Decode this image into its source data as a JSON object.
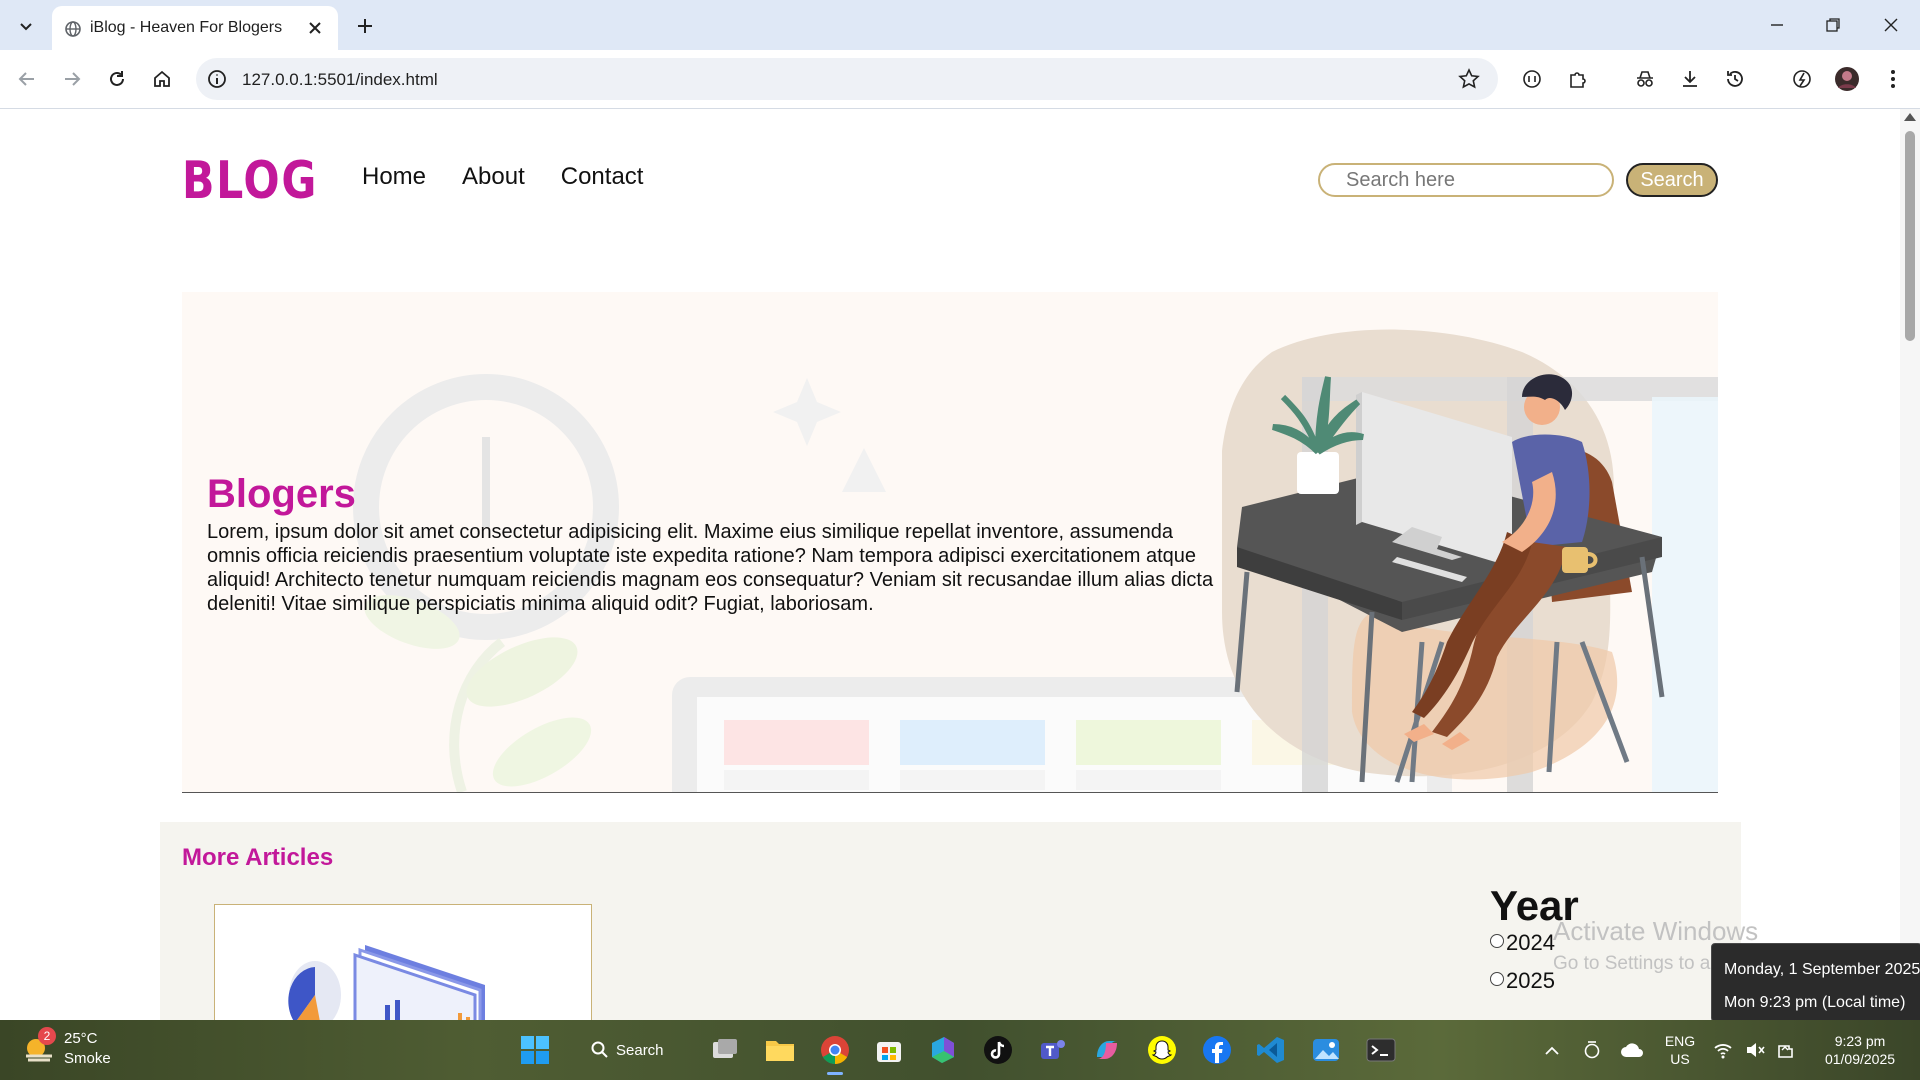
{
  "browser": {
    "tab_title": "iBlog - Heaven For Blogers",
    "url": "127.0.0.1:5501/index.html"
  },
  "site": {
    "logo": "BLOG",
    "nav": [
      "Home",
      "About",
      "Contact"
    ],
    "search_placeholder": "Search here",
    "search_button": "Search"
  },
  "hero": {
    "title": "Blogers",
    "text": "Lorem, ipsum dolor sit amet consectetur adipisicing elit. Maxime eius similique repellat inventore, assumenda omnis officia reiciendis praesentium voluptate iste expedita ratione? Nam tempora adipisci exercitationem atque aliquid! Architecto tenetur numquam reiciendis magnam eos consequatur? Veniam sit recusandae illum alias dicta deleniti! Vitae similique perspiciatis minima aliquid odit? Fugiat, laboriosam."
  },
  "articles": {
    "title": "More Articles",
    "filter_title": "Year",
    "years": [
      "2024",
      "2025"
    ]
  },
  "watermark": {
    "line1": "Activate Windows",
    "line2": "Go to Settings to activate Windows."
  },
  "tooltip": {
    "date": "Monday, 1 September 2025",
    "time": "Mon 9:23 pm (Local time)"
  },
  "taskbar": {
    "weather_badge": "2",
    "temperature": "25°C",
    "condition": "Smoke",
    "search_label": "Search",
    "language": "ENG",
    "region": "US",
    "clock_time": "9:23 pm",
    "clock_date": "01/09/2025"
  },
  "colors": {
    "brand": "#c2189a",
    "accent_gold": "#c9b277",
    "hero_bg": "#fef9f5",
    "section_bg": "#f5f4ef"
  }
}
